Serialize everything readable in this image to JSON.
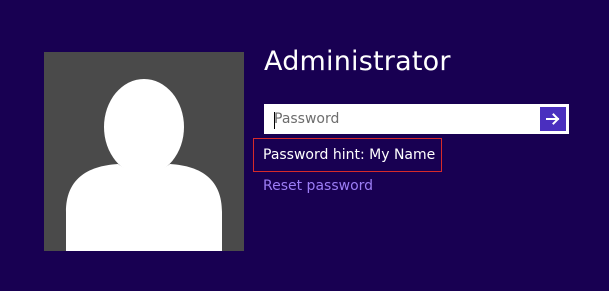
{
  "user": {
    "name": "Administrator"
  },
  "password": {
    "placeholder": "Password",
    "value": "",
    "submit_icon": "arrow-right-icon"
  },
  "hint": {
    "text": "Password hint: My Name"
  },
  "links": {
    "reset_label": "Reset password"
  },
  "colors": {
    "background": "#180052",
    "avatar_tile": "#4a4a4a",
    "submit_button": "#4a2fbf",
    "link": "#9c7df5",
    "highlight_border": "#d62a2a"
  }
}
